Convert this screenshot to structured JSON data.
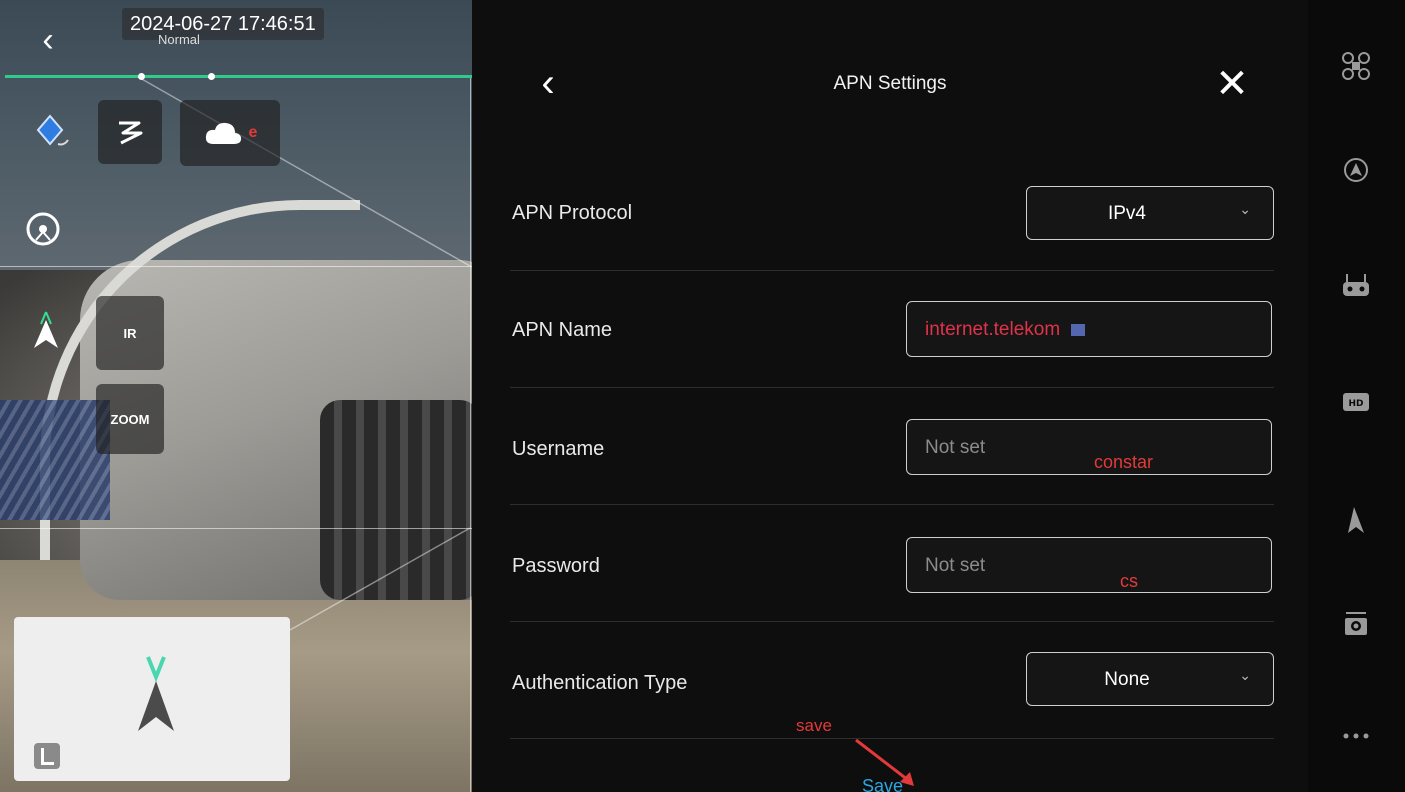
{
  "camera": {
    "timestamp": "2024-06-27 17:46:51",
    "flight_mode": "Normal",
    "ir_label": "IR",
    "zoom_label": "ZOOM",
    "cloud_badge": "e"
  },
  "panel": {
    "title": "APN Settings",
    "rows": [
      {
        "label": "APN Protocol",
        "value": "IPv4"
      },
      {
        "label": "APN Name",
        "value": "internet.telekom"
      },
      {
        "label": "Username",
        "placeholder": "Not set"
      },
      {
        "label": "Password",
        "placeholder": "Not set"
      },
      {
        "label": "Authentication Type",
        "value": "None"
      }
    ],
    "save_label": "Save"
  },
  "annotations": {
    "username_note": "constar",
    "password_note": "cs",
    "save_note": "save"
  },
  "colors": {
    "accent_green": "#2ecc8b",
    "annotation_red": "#e23a3a",
    "link_blue": "#2aa6e0"
  },
  "toolbar_icons": [
    "drone-icon",
    "autopilot-icon",
    "remote-controller-icon",
    "hd-icon",
    "map-style-icon",
    "camera-icon",
    "more-icon"
  ]
}
